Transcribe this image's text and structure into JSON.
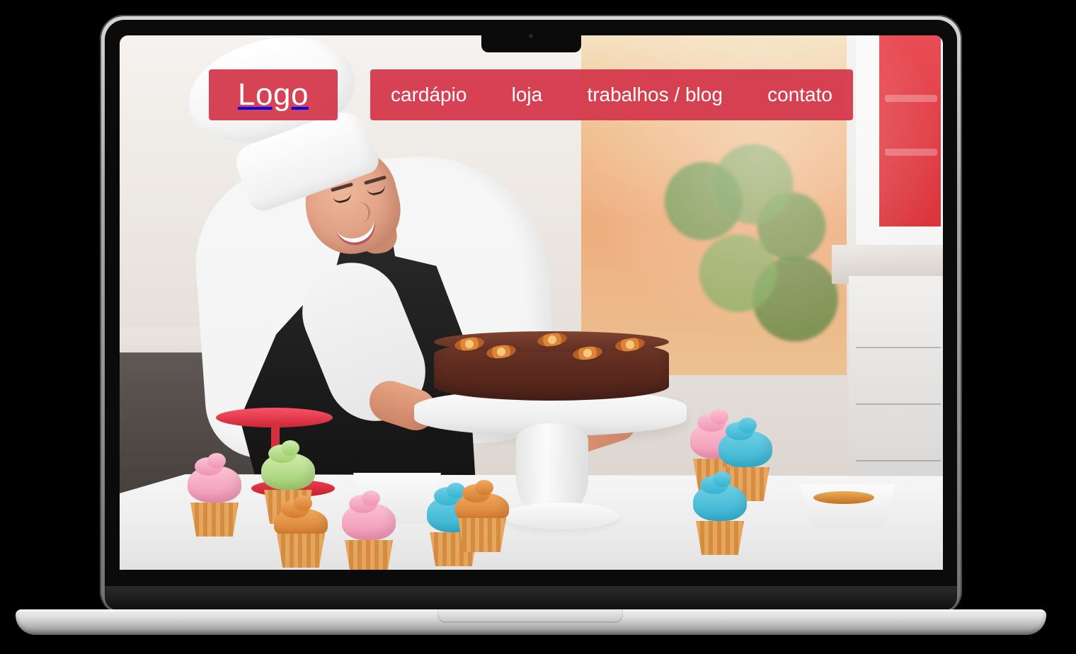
{
  "site": {
    "logo_text": "Logo",
    "nav": [
      {
        "label": "cardápio"
      },
      {
        "label": "loja"
      },
      {
        "label": "trabalhos / blog"
      },
      {
        "label": "contato"
      }
    ]
  },
  "colors": {
    "header_background": "#d3374a",
    "header_text": "#ffffff",
    "laptop_frame": "#bdbdbd",
    "page_background": "#000000"
  }
}
